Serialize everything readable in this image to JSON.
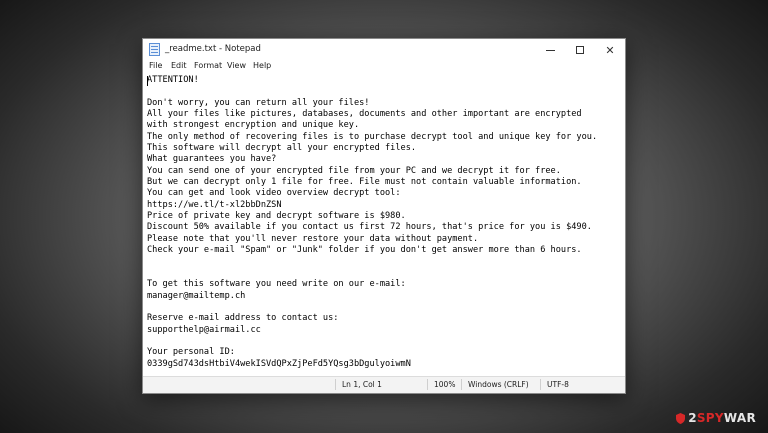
{
  "window": {
    "title": "_readme.txt - Notepad",
    "minimize_glyph": "",
    "close_glyph": "✕"
  },
  "menu": {
    "items": [
      "File",
      "Edit",
      "Format",
      "View",
      "Help"
    ]
  },
  "document": {
    "lines": [
      "ATTENTION!",
      "",
      "Don't worry, you can return all your files!",
      "All your files like pictures, databases, documents and other important are encrypted",
      "with strongest encryption and unique key.",
      "The only method of recovering files is to purchase decrypt tool and unique key for you.",
      "This software will decrypt all your encrypted files.",
      "What guarantees you have?",
      "You can send one of your encrypted file from your PC and we decrypt it for free.",
      "But we can decrypt only 1 file for free. File must not contain valuable information.",
      "You can get and look video overview decrypt tool:",
      "https://we.tl/t-xl2bbDnZSN",
      "Price of private key and decrypt software is $980.",
      "Discount 50% available if you contact us first 72 hours, that's price for you is $490.",
      "Please note that you'll never restore your data without payment.",
      "Check your e-mail \"Spam\" or \"Junk\" folder if you don't get answer more than 6 hours.",
      "",
      "",
      "To get this software you need write on our e-mail:",
      "manager@mailtemp.ch",
      "",
      "Reserve e-mail address to contact us:",
      "supporthelp@airmail.cc",
      "",
      "Your personal ID:",
      "0339gSd743dsHtbiV4wekISVdQPxZjPeFd5YQsg3bDgulyoiwmN"
    ]
  },
  "status": {
    "position": "Ln 1, Col 1",
    "zoom": "100%",
    "line_ending": "Windows (CRLF)",
    "encoding": "UTF-8"
  },
  "watermark": {
    "prefix": "2",
    "accent": "SPY",
    "suffix": "WAR",
    "accent_color": "#d62828"
  }
}
